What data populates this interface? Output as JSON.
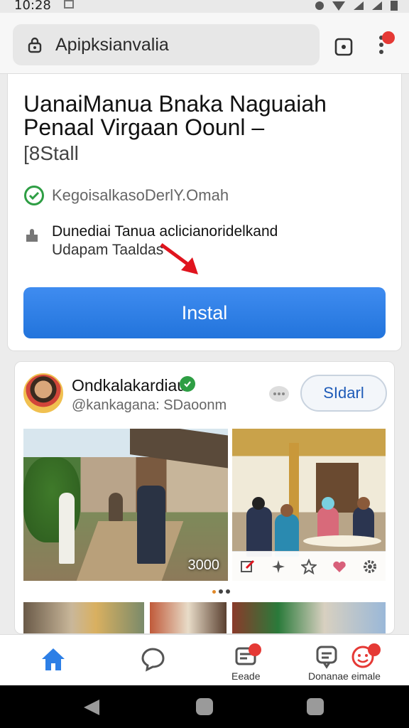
{
  "status_bar": {
    "time": "10:28"
  },
  "browser": {
    "url": "Apipksianvalia"
  },
  "app": {
    "title": "UanaiManua Bnaka Naguaiah Penaal Virgaan Oounl –",
    "install_small": "[8Stall",
    "verified_text": "KegoisalkasoDerlY.Omah",
    "desc_line1": "Dunediai Tanua aclicianoridelkand",
    "desc_line2": "Udapam Taaldas",
    "install_button": "Instal"
  },
  "post": {
    "publisher_name": "Ondkalakardiau",
    "publisher_handle": "@kankagana: SDaoonm",
    "follow_button": "SIdarl",
    "photo_badge": "3000"
  },
  "bottom_nav": {
    "item3_label": "Eeade",
    "item4_label": "Donanae eimale"
  },
  "colors": {
    "accent": "#2d7fe6",
    "verified": "#2e9e44",
    "notification": "#e53935",
    "arrow": "#e0141e"
  },
  "icons": [
    "lock-icon",
    "tab-switcher-icon",
    "menu-dots-icon",
    "check-circle-icon",
    "puzzle-icon",
    "arrow-icon",
    "chat-icon",
    "home-icon",
    "messages-icon",
    "bell-icon",
    "profile-icon"
  ]
}
